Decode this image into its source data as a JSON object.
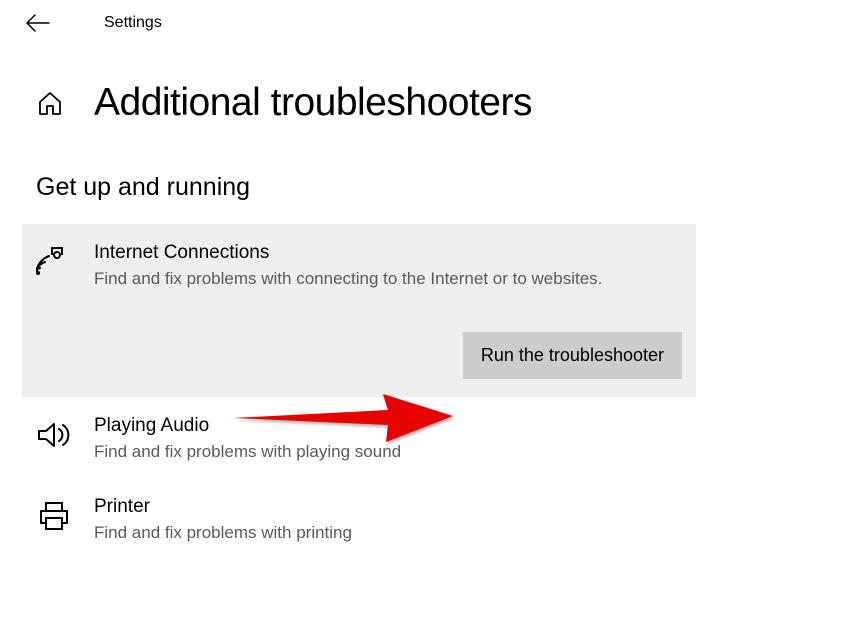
{
  "header": {
    "app_title": "Settings"
  },
  "page": {
    "title": "Additional troubleshooters"
  },
  "section": {
    "title": "Get up and running"
  },
  "troubleshooters": [
    {
      "title": "Internet Connections",
      "description": "Find and fix problems with connecting to the Internet or to websites.",
      "selected": true
    },
    {
      "title": "Playing Audio",
      "description": "Find and fix problems with playing sound",
      "selected": false
    },
    {
      "title": "Printer",
      "description": "Find and fix problems with printing",
      "selected": false
    }
  ],
  "buttons": {
    "run_troubleshooter": "Run the troubleshooter"
  }
}
